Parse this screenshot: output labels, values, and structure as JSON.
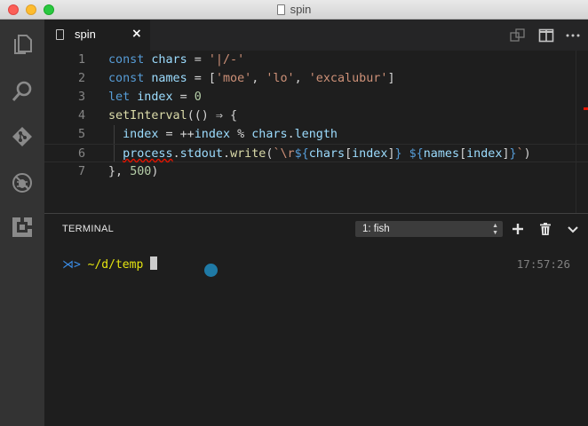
{
  "window": {
    "title": "spin"
  },
  "tab": {
    "label": "spin",
    "close": "×"
  },
  "editor": {
    "lines": [
      {
        "num": "1",
        "parts": [
          [
            "kw",
            "const"
          ],
          [
            "t",
            " "
          ],
          [
            "var",
            "chars"
          ],
          [
            "t",
            " = "
          ],
          [
            "str",
            "'|/-'"
          ]
        ]
      },
      {
        "num": "2",
        "parts": [
          [
            "kw",
            "const"
          ],
          [
            "t",
            " "
          ],
          [
            "var",
            "names"
          ],
          [
            "t",
            " = ["
          ],
          [
            "str",
            "'moe'"
          ],
          [
            "t",
            ", "
          ],
          [
            "str",
            "'lo'"
          ],
          [
            "t",
            ", "
          ],
          [
            "str",
            "'excalubur'"
          ],
          [
            "t",
            "]"
          ]
        ]
      },
      {
        "num": "3",
        "parts": [
          [
            "kw",
            "let"
          ],
          [
            "t",
            " "
          ],
          [
            "var",
            "index"
          ],
          [
            "t",
            " = "
          ],
          [
            "num",
            "0"
          ]
        ]
      },
      {
        "num": "4",
        "parts": [
          [
            "fn",
            "setInterval"
          ],
          [
            "t",
            "(() ⇒ {"
          ]
        ]
      },
      {
        "num": "5",
        "parts": [
          [
            "t",
            "  "
          ],
          [
            "var",
            "index"
          ],
          [
            "t",
            " = ++"
          ],
          [
            "var",
            "index"
          ],
          [
            "t",
            " % "
          ],
          [
            "var",
            "chars"
          ],
          [
            "t",
            "."
          ],
          [
            "var",
            "length"
          ]
        ]
      },
      {
        "num": "6",
        "parts": [
          [
            "t",
            "  "
          ],
          [
            "sq",
            "process"
          ],
          [
            "t",
            "."
          ],
          [
            "var",
            "stdout"
          ],
          [
            "t",
            "."
          ],
          [
            "fn",
            "write"
          ],
          [
            "t",
            "("
          ],
          [
            "str",
            "`\\r"
          ],
          [
            "tpl",
            "${"
          ],
          [
            "var",
            "chars"
          ],
          [
            "t",
            "["
          ],
          [
            "var",
            "index"
          ],
          [
            "t",
            "]"
          ],
          [
            "tpl",
            "}"
          ],
          [
            "str",
            " "
          ],
          [
            "tpl",
            "${"
          ],
          [
            "var",
            "names"
          ],
          [
            "t",
            "["
          ],
          [
            "var",
            "index"
          ],
          [
            "t",
            "]"
          ],
          [
            "tpl",
            "}"
          ],
          [
            "str",
            "`"
          ],
          [
            "t",
            ")"
          ]
        ]
      },
      {
        "num": "7",
        "parts": [
          [
            "t",
            "}, "
          ],
          [
            "num",
            "500"
          ],
          [
            "t",
            ")"
          ]
        ]
      }
    ]
  },
  "panel": {
    "title": "TERMINAL",
    "terminal_select": "1: fish",
    "prompt_symbol": "⋊>",
    "prompt_path": "~/d/temp",
    "time": "17:57:26"
  }
}
